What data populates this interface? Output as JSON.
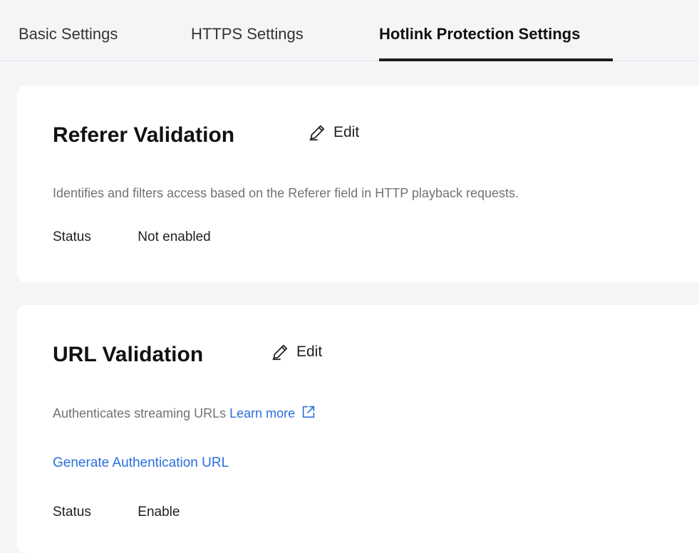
{
  "tabs": [
    {
      "label": "Basic Settings"
    },
    {
      "label": "HTTPS Settings"
    },
    {
      "label": "Hotlink Protection Settings"
    }
  ],
  "referer": {
    "title": "Referer Validation",
    "edit_label": "Edit",
    "description": "Identifies and filters access based on the Referer field in HTTP playback requests.",
    "status_label": "Status",
    "status_value": "Not enabled"
  },
  "url_validation": {
    "title": "URL Validation",
    "edit_label": "Edit",
    "description": "Authenticates streaming URLs",
    "learn_more": "Learn more",
    "generate_link": "Generate Authentication URL",
    "status_label": "Status",
    "status_value": "Enable"
  },
  "colors": {
    "link": "#2a6fdb",
    "page_bg": "#f4f5f7",
    "card_bg": "#ffffff",
    "active_tab_underline": "#1f1f1f"
  },
  "icons": {
    "edit": "pencil-icon",
    "external_link": "external-link-icon"
  }
}
